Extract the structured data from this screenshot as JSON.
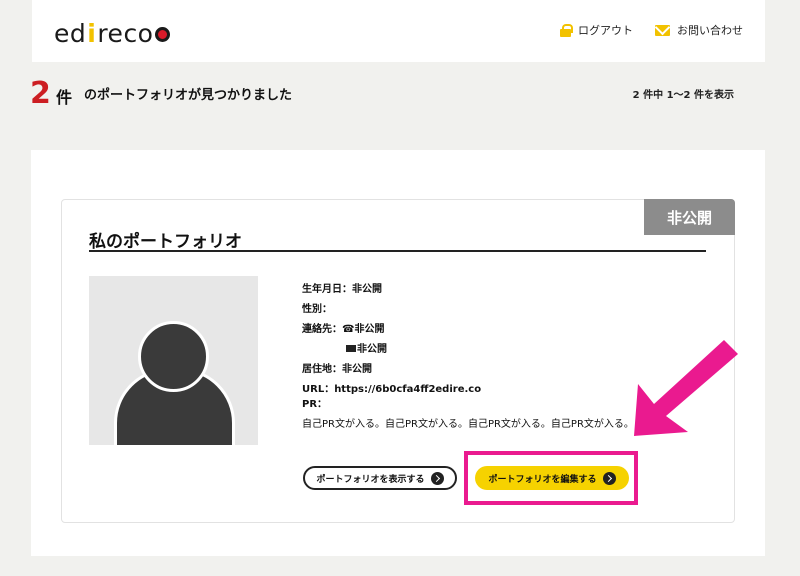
{
  "header": {
    "logo": {
      "part1": "ed",
      "slash": "i",
      "part2": "reco"
    },
    "nav": [
      {
        "label": "ログアウト",
        "icon": "lock-icon"
      },
      {
        "label": "お問い合わせ",
        "icon": "mail-icon"
      }
    ]
  },
  "results": {
    "count": "2",
    "unit": "件",
    "message": "のポートフォリオが見つかりました",
    "range": "2 件中 1〜2 件を表示"
  },
  "card": {
    "status": "非公開",
    "title": "私のポートフォリオ",
    "profile": {
      "birthday": "生年月日：非公開",
      "gender": "性別：",
      "contact_phone": "連絡先：☎非公開",
      "contact_email": "非公開",
      "residence": "居住地：非公開",
      "url": "URL：https://6b0cfa4ff2edire.co",
      "pr_label": "PR：",
      "pr_text": "自己PR文が入る。自己PR文が入る。自己PR文が入る。自己PR文が入る。"
    },
    "buttons": {
      "view": "ポートフォリオを表示する",
      "edit": "ポートフォリオを編集する"
    }
  },
  "colors": {
    "accent_yellow": "#f6d200",
    "count_red": "#cc1e22",
    "highlight_pink": "#ea1a8f",
    "badge_gray": "#8c8c8c"
  }
}
